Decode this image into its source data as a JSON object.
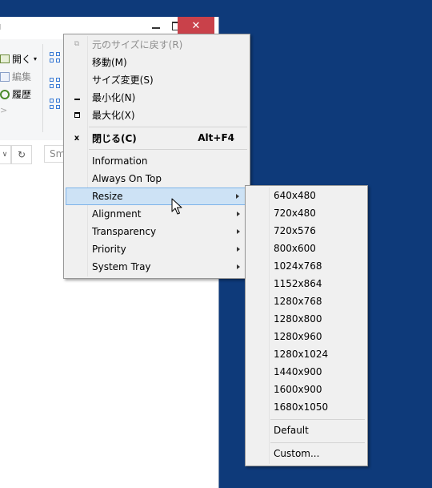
{
  "window": {
    "title_fragment": "ı",
    "close_glyph": "✕",
    "ribbon": {
      "open_label": "開く",
      "edit_label": "編集",
      "history_label": "履歴"
    },
    "address": {
      "refresh_glyph": "↻",
      "back_glyph": "∨",
      "search_placeholder": "Sm"
    }
  },
  "system_menu": {
    "items": [
      {
        "label": "元のサイズに戻す(R)",
        "disabled": true,
        "icon": "restore-icon"
      },
      {
        "label": "移動(M)"
      },
      {
        "label": "サイズ変更(S)"
      },
      {
        "label": "最小化(N)",
        "icon": "minimize-icon"
      },
      {
        "label": "最大化(X)",
        "icon": "maximize-icon"
      },
      {
        "label": "閉じる(C)",
        "shortcut": "Alt+F4",
        "bold": true,
        "icon": "close-icon"
      },
      {
        "label": "Information"
      },
      {
        "label": "Always On Top"
      },
      {
        "label": "Resize",
        "submenu": true,
        "highlighted": true
      },
      {
        "label": "Alignment",
        "submenu": true
      },
      {
        "label": "Transparency",
        "submenu": true
      },
      {
        "label": "Priority",
        "submenu": true
      },
      {
        "label": "System Tray",
        "submenu": true
      }
    ]
  },
  "resize_submenu": {
    "sizes": [
      "640x480",
      "720x480",
      "720x576",
      "800x600",
      "1024x768",
      "1152x864",
      "1280x768",
      "1280x800",
      "1280x960",
      "1280x1024",
      "1440x900",
      "1600x900",
      "1680x1050"
    ],
    "default_label": "Default",
    "custom_label": "Custom..."
  },
  "colors": {
    "desktop": "#0e3a7a",
    "menu_bg": "#f0f0f0",
    "highlight_bg": "#cde2f5",
    "highlight_border": "#7eb4ea",
    "close_button": "#c9414a"
  }
}
